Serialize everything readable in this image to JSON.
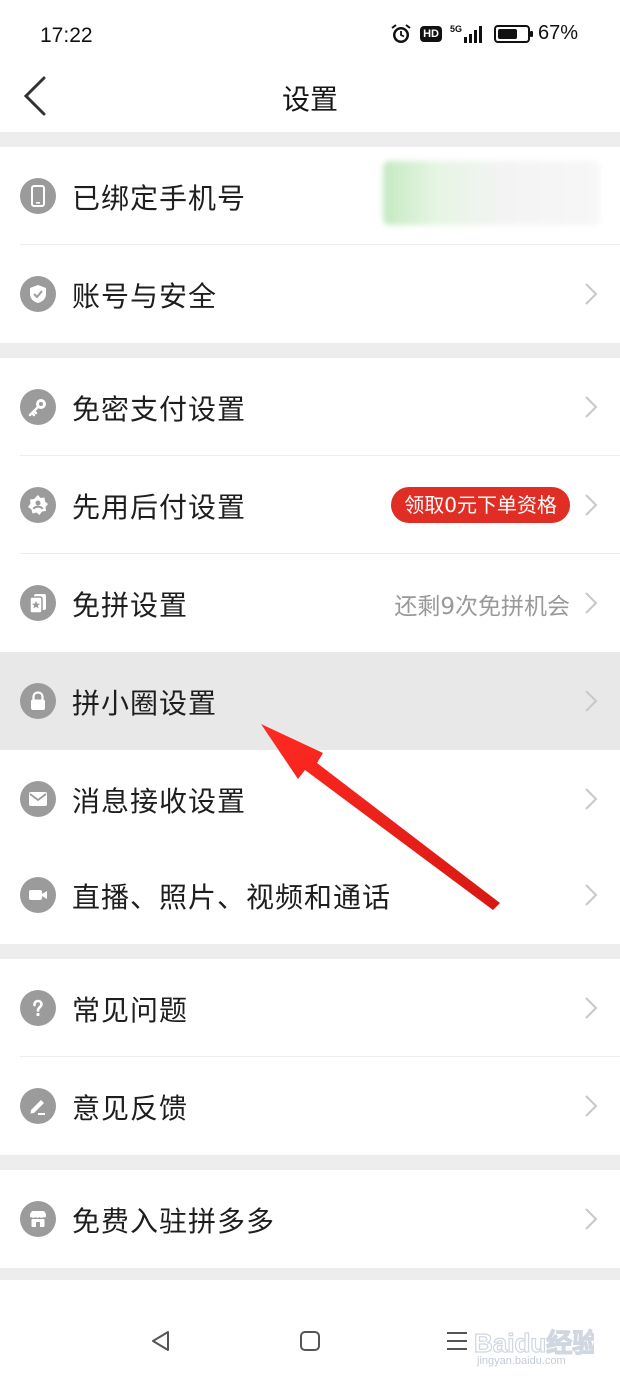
{
  "status_bar": {
    "time": "17:22",
    "hd": "HD",
    "network": "5G",
    "battery_percent": "67%",
    "battery_level": 0.67
  },
  "header": {
    "title": "设置"
  },
  "sections": [
    {
      "items": [
        {
          "label": "已绑定手机号",
          "icon": "phone-icon"
        },
        {
          "label": "账号与安全",
          "icon": "shield-icon"
        }
      ]
    },
    {
      "items": [
        {
          "label": "免密支付设置",
          "icon": "key-icon"
        },
        {
          "label": "先用后付设置",
          "icon": "gear-badge-icon",
          "badge": "领取0元下单资格"
        },
        {
          "label": "免拼设置",
          "icon": "card-icon",
          "extra": "还剩9次免拼机会"
        },
        {
          "label": "拼小圈设置",
          "icon": "lock-icon"
        },
        {
          "label": "消息接收设置",
          "icon": "mail-icon"
        },
        {
          "label": "直播、照片、视频和通话",
          "icon": "video-icon"
        }
      ]
    },
    {
      "items": [
        {
          "label": "常见问题",
          "icon": "question-icon"
        },
        {
          "label": "意见反馈",
          "icon": "pen-icon"
        }
      ]
    },
    {
      "items": [
        {
          "label": "免费入驻拼多多",
          "icon": "store-icon"
        }
      ]
    }
  ],
  "colors": {
    "accent_red": "#e02e24",
    "annotation_arrow": "#e8201e",
    "icon_gray": "#9b9b9b",
    "divider": "#ededed"
  },
  "watermark": {
    "brand": "Baidu经验",
    "url": "jingyan.baidu.com"
  }
}
